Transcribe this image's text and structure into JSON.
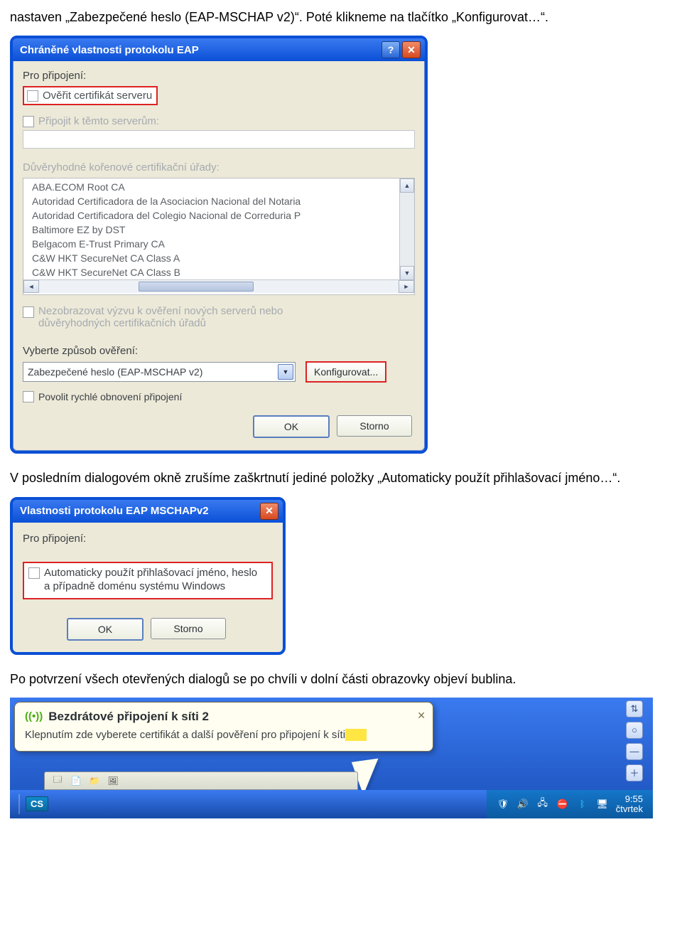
{
  "doc": {
    "p1": "nastaven „Zabezpečené heslo (EAP-MSCHAP v2)“. Poté klikneme na tlačítko „Konfigurovat…“.",
    "p2": "V posledním dialogovém okně zrušíme zaškrtnutí jediné položky „Automaticky použít přihlašovací jméno…“.",
    "p3": "Po potvrzení všech otevřených dialogů se po chvíli v dolní části obrazovky objeví bublina."
  },
  "dlg1": {
    "title": "Chráněné vlastnosti protokolu EAP",
    "label_connect": "Pro připojení:",
    "verify_cert": "Ověřit certifikát serveru",
    "connect_servers": "Připojit k těmto serverům:",
    "trusted_roots": "Důvěryhodné kořenové certifikační úřady:",
    "certs": [
      "ABA.ECOM Root CA",
      "Autoridad Certificadora de la Asociacion Nacional del Notaria",
      "Autoridad Certificadora del Colegio Nacional de Correduria P",
      "Baltimore EZ by DST",
      "Belgacom E-Trust Primary CA",
      "C&W HKT SecureNet CA Class A",
      "C&W HKT SecureNet CA Class B"
    ],
    "no_prompt": "Nezobrazovat výzvu k ověření nových serverů nebo důvěryhodných certifikačních úřadů",
    "select_auth": "Vyberte způsob ověření:",
    "auth_value": "Zabezpečené heslo (EAP-MSCHAP v2)",
    "configure": "Konfigurovat...",
    "fast_reconnect": "Povolit rychlé obnovení připojení",
    "ok": "OK",
    "cancel": "Storno"
  },
  "dlg2": {
    "title": "Vlastnosti protokolu EAP MSCHAPv2",
    "label_connect": "Pro připojení:",
    "auto_use": "Automaticky použít přihlašovací jméno, heslo a případně doménu systému Windows",
    "ok": "OK",
    "cancel": "Storno"
  },
  "balloon": {
    "title": "Bezdrátové připojení k síti 2",
    "body_a": "Klepnutím zde vyberete certifikát a další pověření pro připojení k síti",
    "body_hl": " "
  },
  "taskbar": {
    "lang": "CS",
    "time": "9:55",
    "day": "čtvrtek"
  }
}
